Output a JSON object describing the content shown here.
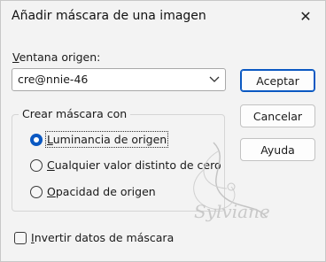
{
  "dialog": {
    "title": "Añadir máscara de una imagen",
    "close_glyph": "✕"
  },
  "source": {
    "label_prefix": "V",
    "label_rest": "entana origen:",
    "selected_value": "cre@nnie-46"
  },
  "buttons": {
    "accept": "Aceptar",
    "cancel": "Cancelar",
    "help": "Ayuda"
  },
  "mask_group": {
    "title": "Crear máscara con",
    "options": [
      {
        "key": "L",
        "rest": "uminancia de origen",
        "checked": true
      },
      {
        "key": "C",
        "rest": "ualquier valor distinto de cero",
        "checked": false
      },
      {
        "key": "O",
        "rest": "pacidad de origen",
        "checked": false
      }
    ]
  },
  "invert": {
    "key": "I",
    "rest": "nvertir datos de máscara",
    "checked": false
  },
  "watermark": {
    "text": "Sylviane"
  },
  "colors": {
    "accent": "#0a58c2",
    "background": "#f3f3f3"
  }
}
